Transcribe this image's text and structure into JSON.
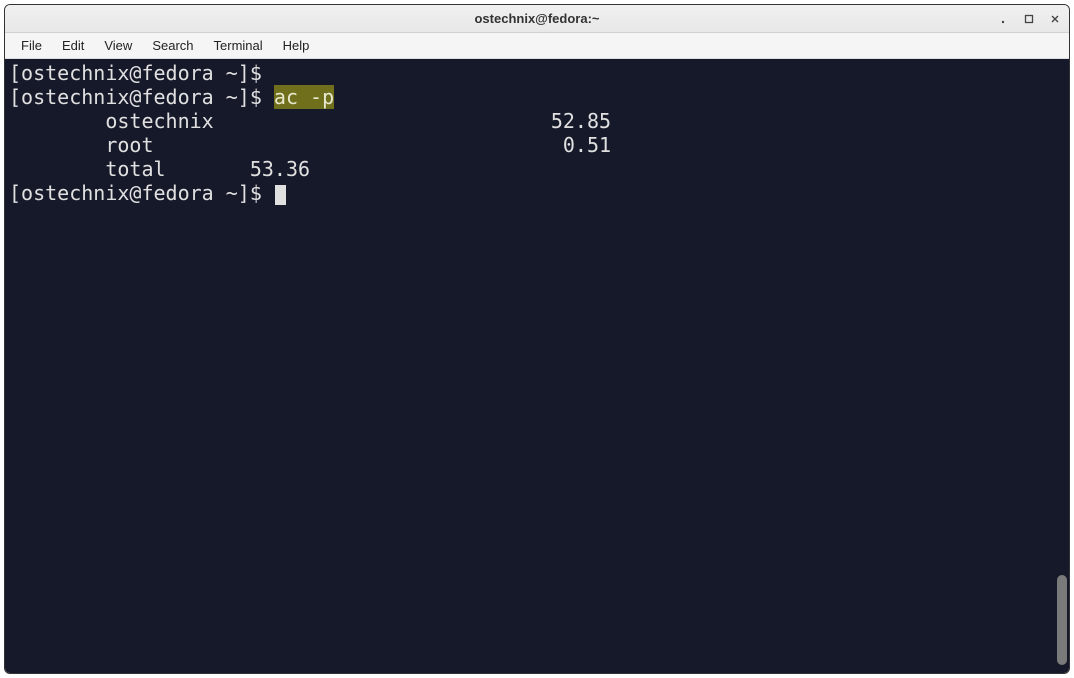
{
  "window": {
    "title": "ostechnix@fedora:~"
  },
  "menubar": {
    "items": [
      "File",
      "Edit",
      "View",
      "Search",
      "Terminal",
      "Help"
    ]
  },
  "terminal": {
    "prompt": "[ostechnix@fedora ~]$ ",
    "lines": {
      "line1_prompt": "[ostechnix@fedora ~]$ ",
      "line2_prompt": "[ostechnix@fedora ~]$ ",
      "line2_cmd": "ac -p",
      "line3": "\tostechnix                            52.85",
      "line4": "\troot                                  0.51",
      "line5": "\ttotal       53.36",
      "line6_prompt": "[ostechnix@fedora ~]$ "
    }
  }
}
